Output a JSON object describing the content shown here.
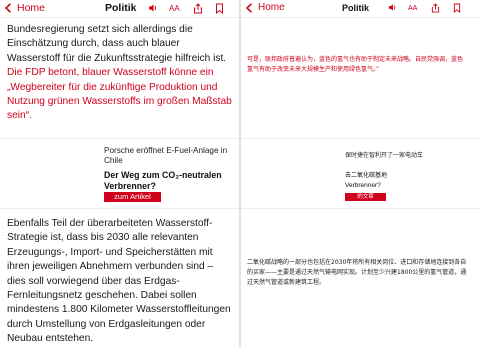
{
  "nav": {
    "back_label": "Home",
    "section_left": "Politik",
    "section_right": "Politik",
    "font_size_label": "AA",
    "accent_color": "#d0021b"
  },
  "left": {
    "paragraph1_black": "Bundesregierung setzt sich allerdings die Einschätzung durch, dass auch blauer Wasserstoff für die Zukunftsstrategie hilfreich ist. ",
    "paragraph1_red": "Die FDP betont, blauer Wasserstoff könne ein „Wegbereiter für die zukünftige Produktion und Nutzung grünen Wasserstoffs im großen Maßstab sein“.",
    "teaser_kicker": "Porsche eröffnet E-Fuel-Anlage in Chile",
    "teaser_headline": "Der Weg zum CO₂-neutralen Verbrenner?",
    "teaser_button": "zum Artikel",
    "paragraph2": "Ebenfalls Teil der überarbeiteten Wasserstoff-Strategie ist, dass bis 2030 alle relevanten Erzeugungs-, Import- und Speicherstätten mit ihren jeweiligen Abnehmern verbunden sind – dies soll vorwiegend über das Erdgas-Fernleitungsnetz geschehen. Dabei sollen mindestens 1.800 Kilometer Wasserstoffleitungen durch Umstellung von Erdgasleitungen oder Neubau entstehen."
  },
  "right": {
    "paragraph1_red": "可是，联邦政府普遍认为，蓝色的氢气也有助于制定未来战略。自民党强调，蓝色氢气有助于改变未来大规模生产和使用绿色氢气。”",
    "teaser_kicker": "保时捷在智利开了一家电动车",
    "teaser_headline_1": "去二氧化碳基地",
    "teaser_headline_2": "Verbrenner?",
    "teaser_button": "的文章",
    "paragraph2": "二氧化碳战略的一部分也包括在2030年将所有相关岗位、进口和存储地连接到各自的买家——主要是通过天然气输电网实现。计划至少兴建1800公里的氢气管道，通过天然气管道或新建筑工程。"
  }
}
